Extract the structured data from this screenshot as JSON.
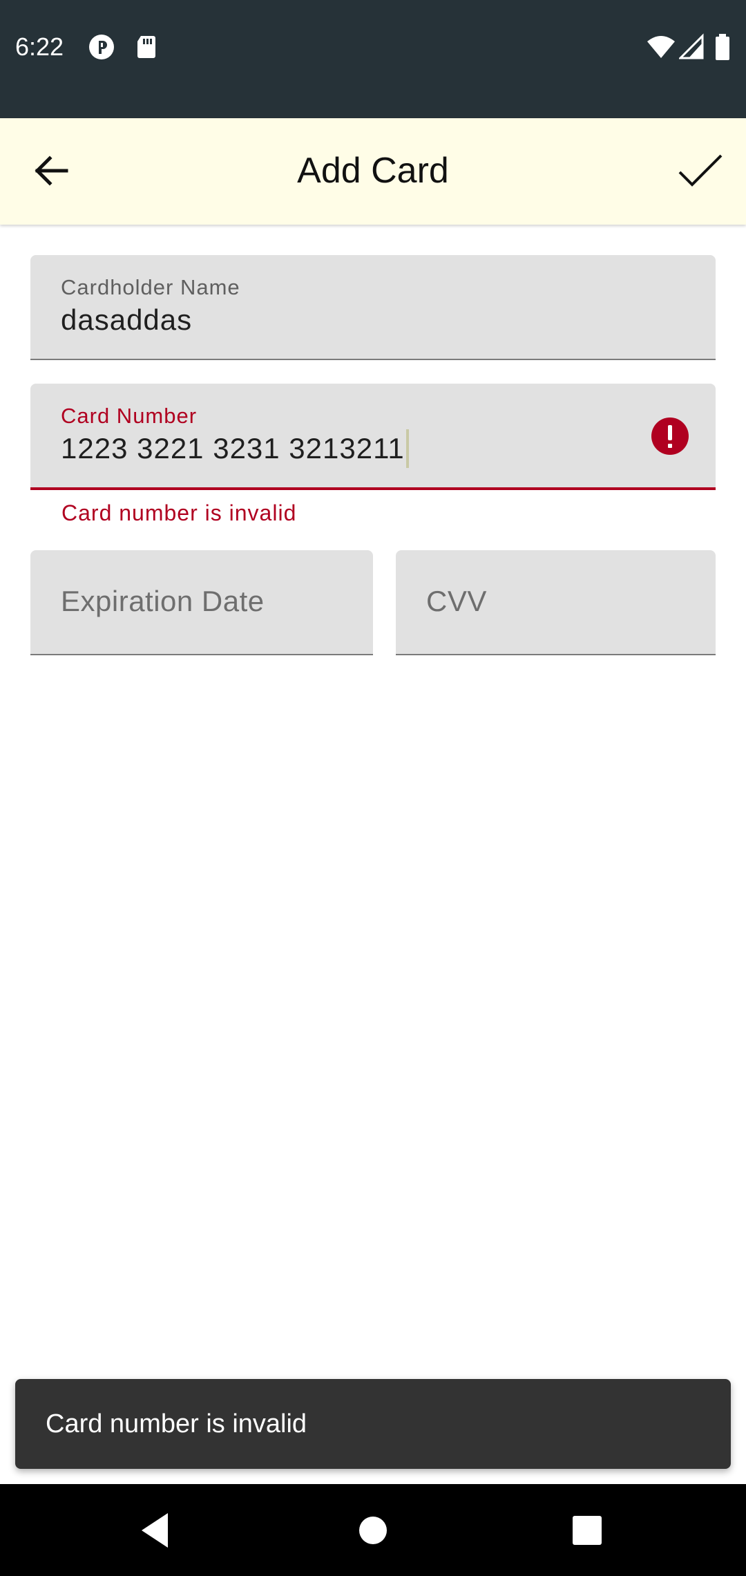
{
  "status_bar": {
    "time": "6:22",
    "left_icons": [
      "notification-p-icon",
      "sd-card-icon"
    ],
    "right_icons": [
      "wifi-icon",
      "signal-icon",
      "battery-icon"
    ]
  },
  "app_bar": {
    "title": "Add Card",
    "back_icon": "arrow-back-icon",
    "confirm_icon": "check-icon"
  },
  "form": {
    "cardholder": {
      "label": "Cardholder Name",
      "value": "dasaddas"
    },
    "card_number": {
      "label": "Card Number",
      "value": "1223 3221 3231 3213211",
      "error_text": "Card number is invalid",
      "error_icon": "error-icon"
    },
    "expiration": {
      "placeholder": "Expiration Date"
    },
    "cvv": {
      "placeholder": "CVV"
    }
  },
  "snackbar": {
    "message": "Card number is invalid"
  },
  "nav_bar": {
    "icons": [
      "back-triangle-icon",
      "home-circle-icon",
      "recents-square-icon"
    ]
  },
  "colors": {
    "status_bar": "#263238",
    "app_bar": "#fffde7",
    "field_bg": "#e1e1e1",
    "error": "#b00020",
    "snackbar": "#333333",
    "nav_bar": "#000000"
  }
}
